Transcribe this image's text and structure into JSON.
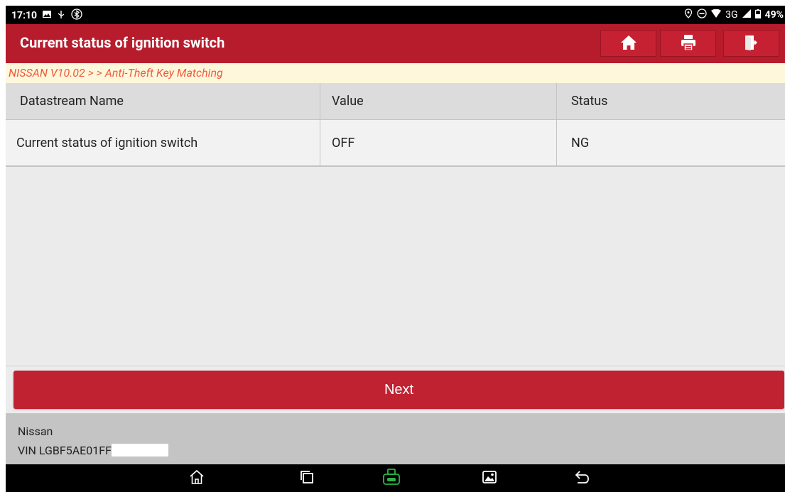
{
  "statusbar": {
    "time": "17:10",
    "network": "3G",
    "battery": "49%"
  },
  "header": {
    "title": "Current status of ignition switch"
  },
  "breadcrumb": {
    "text": "NISSAN V10.02 >  > Anti-Theft Key Matching"
  },
  "table": {
    "columns": [
      "Datastream Name",
      "Value",
      "Status"
    ],
    "rows": [
      [
        "Current status of ignition switch",
        "OFF",
        "NG"
      ]
    ]
  },
  "actions": {
    "next_label": "Next"
  },
  "footer": {
    "make": "Nissan",
    "vin": "VIN LGBF5AE01FF"
  },
  "colors": {
    "accent": "#b71c2c",
    "breadcrumb_text": "#f05a3c",
    "vci_icon": "#2db34a"
  },
  "icons": {
    "header": [
      "home-icon",
      "print-icon",
      "exit-icon"
    ],
    "navbar": [
      "nav-home-icon",
      "recent-apps-icon",
      "vci-icon",
      "gallery-icon",
      "back-icon"
    ]
  }
}
